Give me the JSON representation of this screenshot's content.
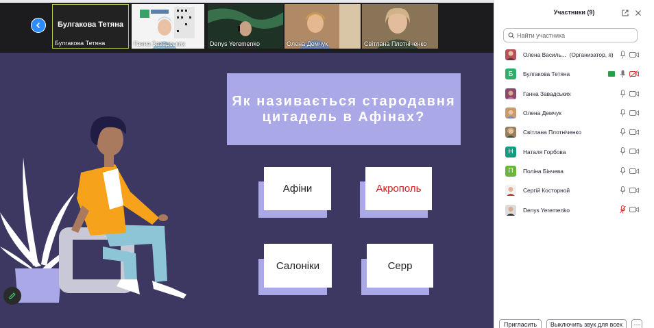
{
  "meeting": {
    "thumbnails": [
      {
        "name": "Булгакова Тетяна",
        "big_name": "Булгакова Тетяна"
      },
      {
        "name": "Ганна Завадських"
      },
      {
        "name": "Denys Yeremenko"
      },
      {
        "name": "Олена Демчук"
      },
      {
        "name": "Світлана Плотніченко"
      }
    ],
    "slide": {
      "question": "Як називається стародавня цитадель в Афінах?",
      "answers": [
        "Афіни",
        "Акрополь",
        "Салоніки",
        "Серр"
      ]
    }
  },
  "panel": {
    "title": "Участники (9)",
    "search_placeholder": "Найти участника",
    "participants": [
      {
        "name": "Олена Василь...",
        "role": "(Организатор, я)",
        "avatar": "photo",
        "mic": "on",
        "cam": "on"
      },
      {
        "name": "Булгакова Тетяна",
        "role": "",
        "avatar_letter": "Б",
        "avatar_color": "#2faf6b",
        "mic": "on",
        "cam": "off",
        "sharing": true
      },
      {
        "name": "Ганна Завадських",
        "role": "",
        "avatar": "photo",
        "mic": "on",
        "cam": "on"
      },
      {
        "name": "Олена Демчук",
        "role": "",
        "avatar": "photo",
        "mic": "on",
        "cam": "on"
      },
      {
        "name": "Світлана Плотніченко",
        "role": "",
        "avatar": "photo",
        "mic": "on",
        "cam": "on"
      },
      {
        "name": "Наталя Горбова",
        "role": "",
        "avatar_letter": "Н",
        "avatar_color": "#159a82",
        "mic": "on",
        "cam": "on"
      },
      {
        "name": "Поліна Бінчева",
        "role": "",
        "avatar_letter": "П",
        "avatar_color": "#6cb33f",
        "mic": "on",
        "cam": "on"
      },
      {
        "name": "Сергій Косторной",
        "role": "",
        "avatar": "photo",
        "mic": "on",
        "cam": "on"
      },
      {
        "name": "Denys Yeremenko",
        "role": "",
        "avatar": "photo",
        "mic": "muted",
        "cam": "on"
      }
    ],
    "invite_label": "Пригласить",
    "mute_all_label": "Выключить звук для всех",
    "more_label": "···"
  },
  "colors": {
    "slide_bg": "#3d3862",
    "accent_lavender": "#aaa8e6",
    "answer_red": "#cc1f1f",
    "zoom_blue": "#2d8cff",
    "muted_red": "#e02828"
  }
}
